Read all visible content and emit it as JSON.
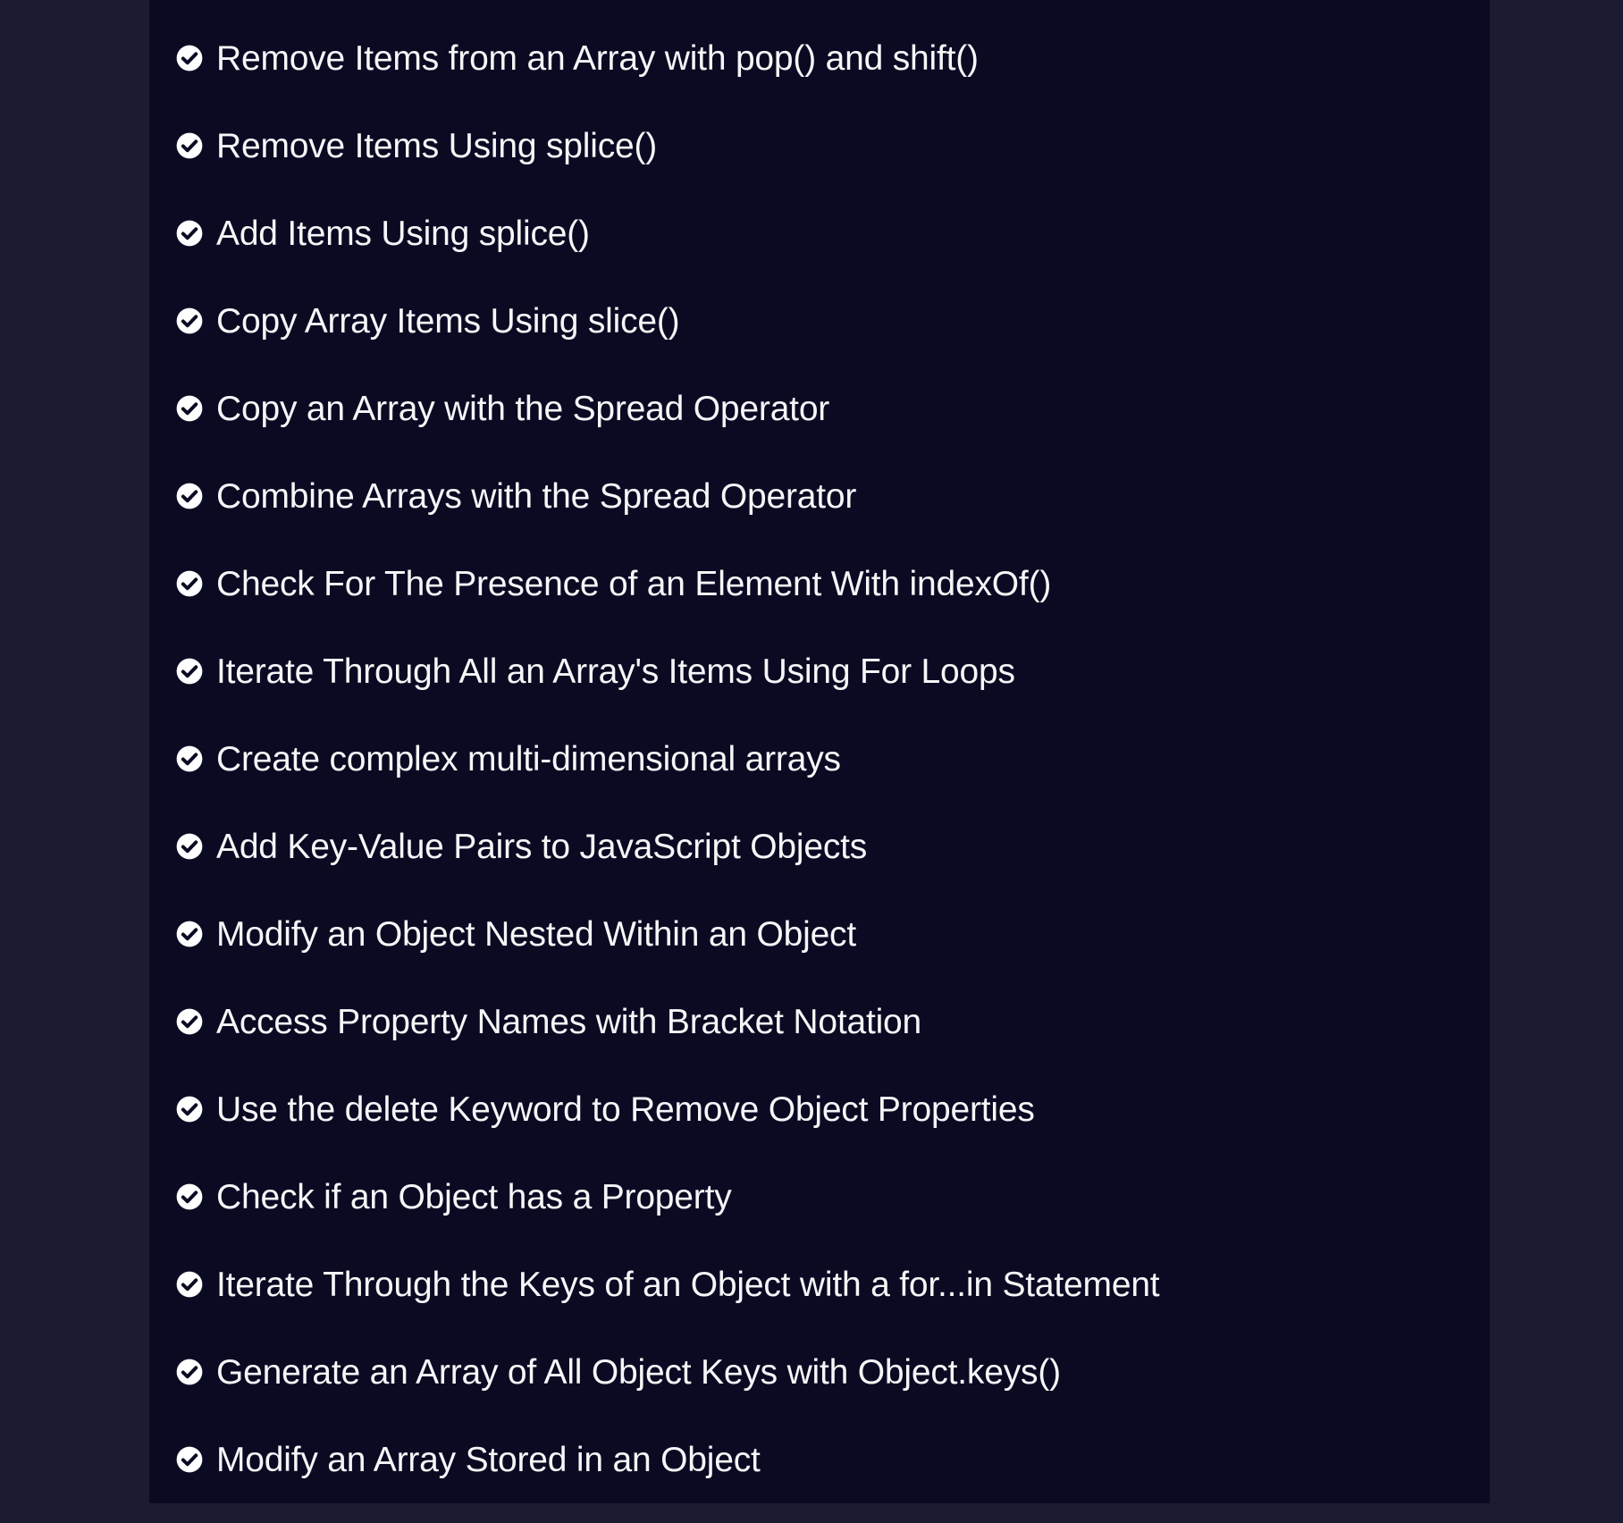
{
  "challenges": {
    "items": [
      {
        "label": "Remove Items from an Array with pop() and shift()",
        "completed": true
      },
      {
        "label": "Remove Items Using splice()",
        "completed": true
      },
      {
        "label": "Add Items Using splice()",
        "completed": true
      },
      {
        "label": "Copy Array Items Using slice()",
        "completed": true
      },
      {
        "label": "Copy an Array with the Spread Operator",
        "completed": true
      },
      {
        "label": "Combine Arrays with the Spread Operator",
        "completed": true
      },
      {
        "label": "Check For The Presence of an Element With indexOf()",
        "completed": true
      },
      {
        "label": "Iterate Through All an Array's Items Using For Loops",
        "completed": true
      },
      {
        "label": "Create complex multi-dimensional arrays",
        "completed": true
      },
      {
        "label": "Add Key-Value Pairs to JavaScript Objects",
        "completed": true
      },
      {
        "label": "Modify an Object Nested Within an Object",
        "completed": true
      },
      {
        "label": "Access Property Names with Bracket Notation",
        "completed": true
      },
      {
        "label": "Use the delete Keyword to Remove Object Properties",
        "completed": true
      },
      {
        "label": "Check if an Object has a Property",
        "completed": true
      },
      {
        "label": "Iterate Through the Keys of an Object with a for...in Statement",
        "completed": true
      },
      {
        "label": "Generate an Array of All Object Keys with Object.keys()",
        "completed": true
      },
      {
        "label": "Modify an Array Stored in an Object",
        "completed": true
      }
    ],
    "icon": "check-circle-icon"
  },
  "colors": {
    "page_background": "#1b1b32",
    "panel_background": "#0a0a23",
    "text": "#f5f6f7",
    "icon": "#ffffff"
  }
}
